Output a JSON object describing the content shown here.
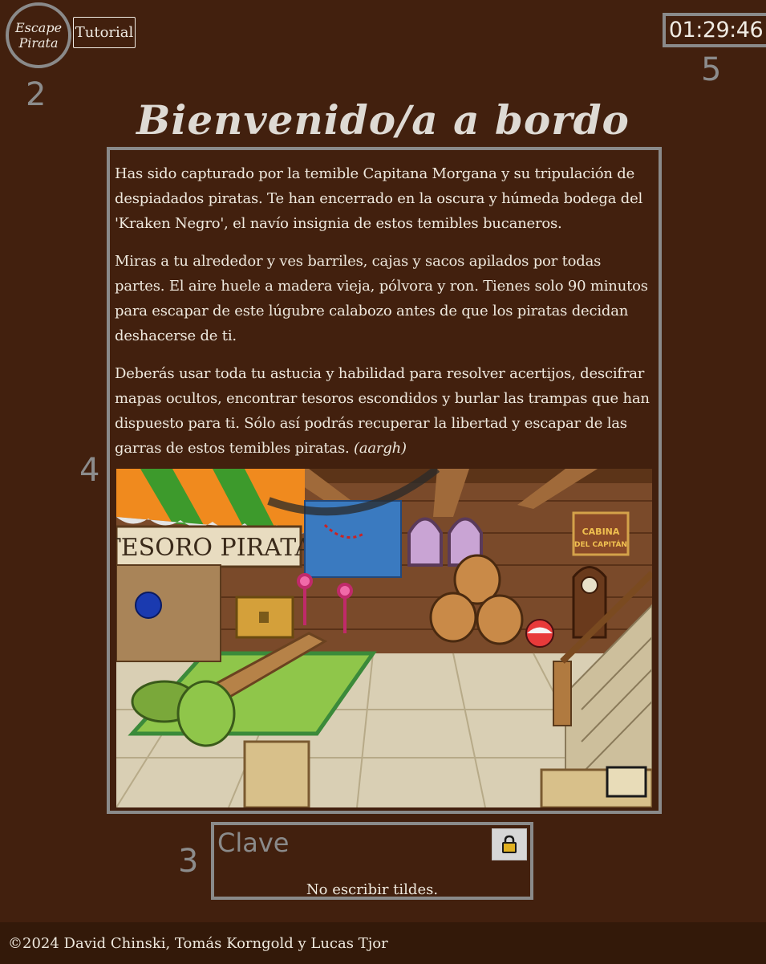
{
  "logo": {
    "line1": "Escape",
    "line2": "Pirata"
  },
  "header": {
    "tutorial_label": "Tutorial",
    "timer": "01:29:46"
  },
  "markers": {
    "m2": "2",
    "m3": "3",
    "m4": "4",
    "m5": "5"
  },
  "title": "Bienvenido/a a bordo",
  "intro": {
    "p1": "Has sido capturado por la temible Capitana Morgana y su tripulación de despiadados piratas. Te han encerrado en la oscura y húmeda bodega del 'Kraken Negro', el navío insignia de estos temibles bucaneros.",
    "p2": "Miras a tu alrededor y ves barriles, cajas y sacos apilados por todas partes. El aire huele a madera vieja, pólvora y ron. Tienes solo 90 minutos para escapar de este lúgubre calabozo antes de que los piratas decidan deshacerse de ti.",
    "p3": "Deberás usar toda tu astucia y habilidad para resolver acertijos, descifrar mapas ocultos, encontrar tesoros escondidos y burlar las trampas que han dispuesto para ti. Sólo así podrás recuperar la libertad y escapar de las garras de estos temibles piratas.",
    "p3_em": "(aargh)"
  },
  "scene": {
    "shop_sign": "TESORO PIRATA",
    "cabin_sign_line1": "CABINA",
    "cabin_sign_line2": "DEL CAPITÁN"
  },
  "answer": {
    "placeholder": "Clave",
    "hint": "No escribir tildes.",
    "lock_icon": "lock-icon"
  },
  "footer": "©2024 David Chinski, Tomás Korngold y Lucas Tjor",
  "colors": {
    "background": "#42200e",
    "border": "#8a8a8a",
    "footer": "#331909"
  }
}
